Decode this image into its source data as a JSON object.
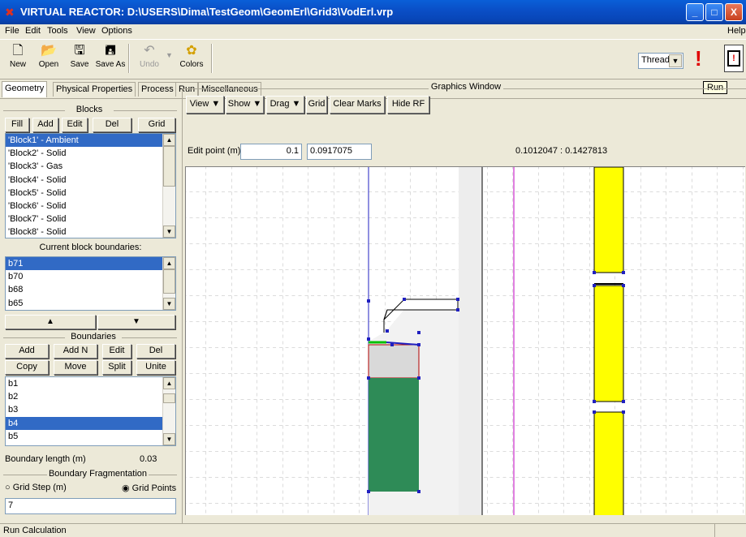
{
  "window": {
    "title": "VIRTUAL REACTOR: D:\\USERS\\Dima\\TestGeom\\GeomErl\\Grid3\\VodErl.vrp",
    "minimize": "_",
    "maximize": "□",
    "close": "X"
  },
  "menu": {
    "items": [
      "File",
      "Edit",
      "Tools",
      "View",
      "Options"
    ],
    "help": "Help"
  },
  "toolbar": {
    "buttons": [
      {
        "label": "New",
        "icon": "new-file-icon"
      },
      {
        "label": "Open",
        "icon": "open-folder-icon"
      },
      {
        "label": "Save",
        "icon": "save-icon"
      },
      {
        "label": "Save As",
        "icon": "save-as-icon"
      },
      {
        "label": "Undo",
        "icon": "undo-icon"
      },
      {
        "label": "Colors",
        "icon": "colors-icon"
      }
    ],
    "thread_select": "Thread",
    "run_tooltip": "Run"
  },
  "tabs": [
    {
      "label": "Geometry",
      "active": true
    },
    {
      "label": "Physical Properties",
      "active": false
    },
    {
      "label": "Process",
      "active": false
    },
    {
      "label": "Run",
      "active": false
    },
    {
      "label": "Miscellaneous",
      "active": false
    }
  ],
  "blocks": {
    "title": "Blocks",
    "buttons": [
      "Fill",
      "Add",
      "Edit",
      "Del",
      "Grid"
    ],
    "items": [
      "'Block1' - Ambient",
      "'Block2' - Solid",
      "'Block3' - Gas",
      "'Block4' - Solid",
      "'Block5' - Solid",
      "'Block6' - Solid",
      "'Block7' - Solid",
      "'Block8' - Solid"
    ],
    "selected_index": 0
  },
  "block_boundaries": {
    "title": "Current block boundaries:",
    "items": [
      "b71",
      "b70",
      "b68",
      "b65"
    ],
    "selected_index": 0
  },
  "boundaries": {
    "title": "Boundaries",
    "buttons_row1": [
      "Add",
      "Add N",
      "Edit",
      "Del"
    ],
    "buttons_row2": [
      "Copy",
      "Move",
      "Split",
      "Unite"
    ],
    "items": [
      "b1",
      "b2",
      "b3",
      "b4",
      "b5"
    ],
    "selected_index": 3,
    "length_label": "Boundary length (m)",
    "length_value": "0.03"
  },
  "fragmentation": {
    "title": "Boundary Fragmentation",
    "option_step": "Grid Step (m)",
    "option_points": "Grid Points",
    "selected": "points",
    "value": "7"
  },
  "graphics": {
    "title": "Graphics Window",
    "toolbar": [
      {
        "label": "View",
        "dropdown": true
      },
      {
        "label": "Show",
        "dropdown": true
      },
      {
        "label": "Drag",
        "dropdown": true
      },
      {
        "label": "Grid",
        "dropdown": false
      },
      {
        "label": "Clear Marks",
        "dropdown": false
      },
      {
        "label": "Hide RF",
        "dropdown": false
      }
    ],
    "edit_point_label": "Edit point (m)",
    "edit_point_x": "0.1",
    "edit_point_y": "0.0917075",
    "cursor_coords": "0.1012047 : 0.1427813"
  },
  "colors": {
    "titlebar": "#0a4fc7",
    "selection": "#316ac5",
    "green_block": "#2e8b57",
    "yellow_block": "#ffff00",
    "gray_block": "#d9d9d9",
    "magenta_line": "#c000c0",
    "blue_line": "#2020c0"
  },
  "status": {
    "text": "Run Calculation"
  }
}
